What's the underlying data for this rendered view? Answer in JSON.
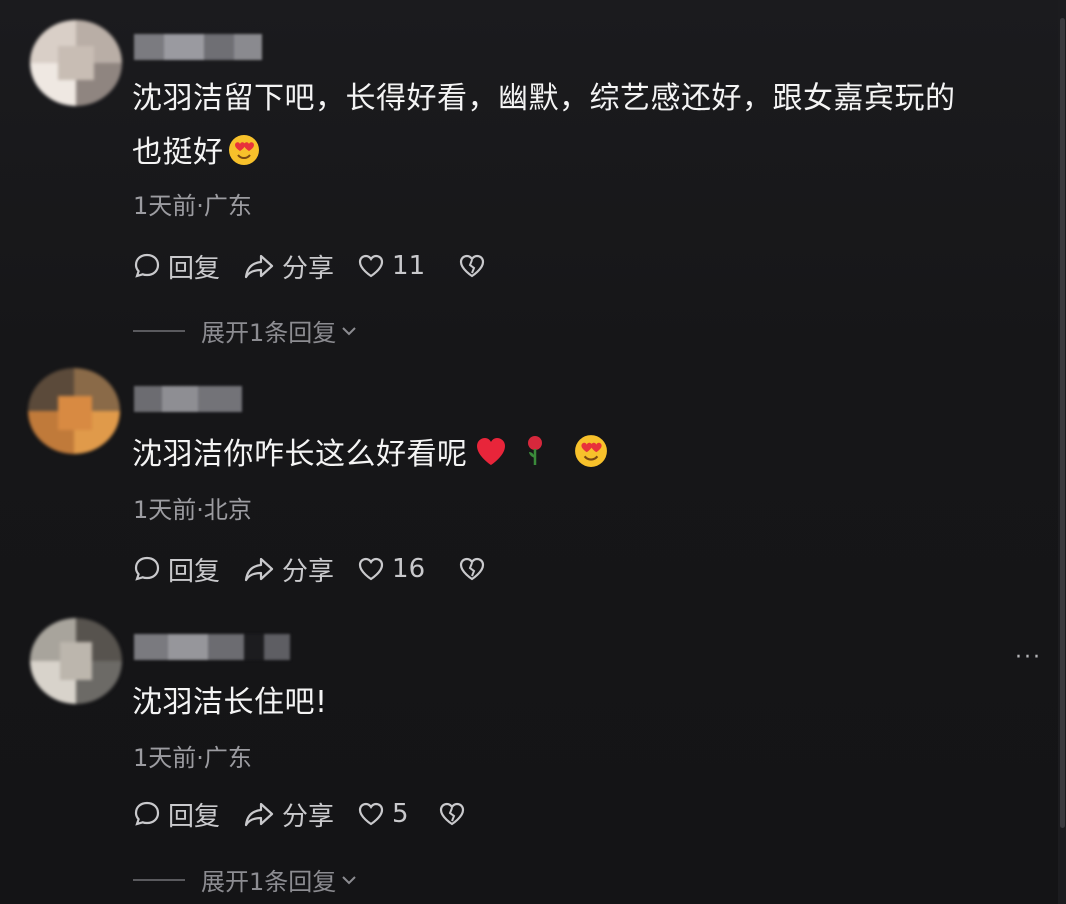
{
  "comments": [
    {
      "text_line1": "沈羽洁留下吧，长得好看，幽默，综艺感还好，跟女嘉宾玩的",
      "text_line2": "也挺好",
      "emojis": [
        "heart-eyes-emoji"
      ],
      "meta": "1天前·广东",
      "reply_label": "回复",
      "share_label": "分享",
      "likes": "11",
      "expand_label": "展开1条回复"
    },
    {
      "text_line1": "沈羽洁你咋长这么好看呢",
      "emojis": [
        "red-heart-emoji",
        "rose-emoji",
        "heart-eyes-emoji"
      ],
      "meta": "1天前·北京",
      "reply_label": "回复",
      "share_label": "分享",
      "likes": "16"
    },
    {
      "text_line1": "沈羽洁长住吧!",
      "meta": "1天前·广东",
      "reply_label": "回复",
      "share_label": "分享",
      "likes": "5",
      "expand_label": "展开1条回复"
    }
  ],
  "more_label": "···",
  "colors": {
    "background": "#161618",
    "text": "#f4f4f4",
    "meta": "#9c9ca1",
    "action": "#c9c9cc"
  }
}
